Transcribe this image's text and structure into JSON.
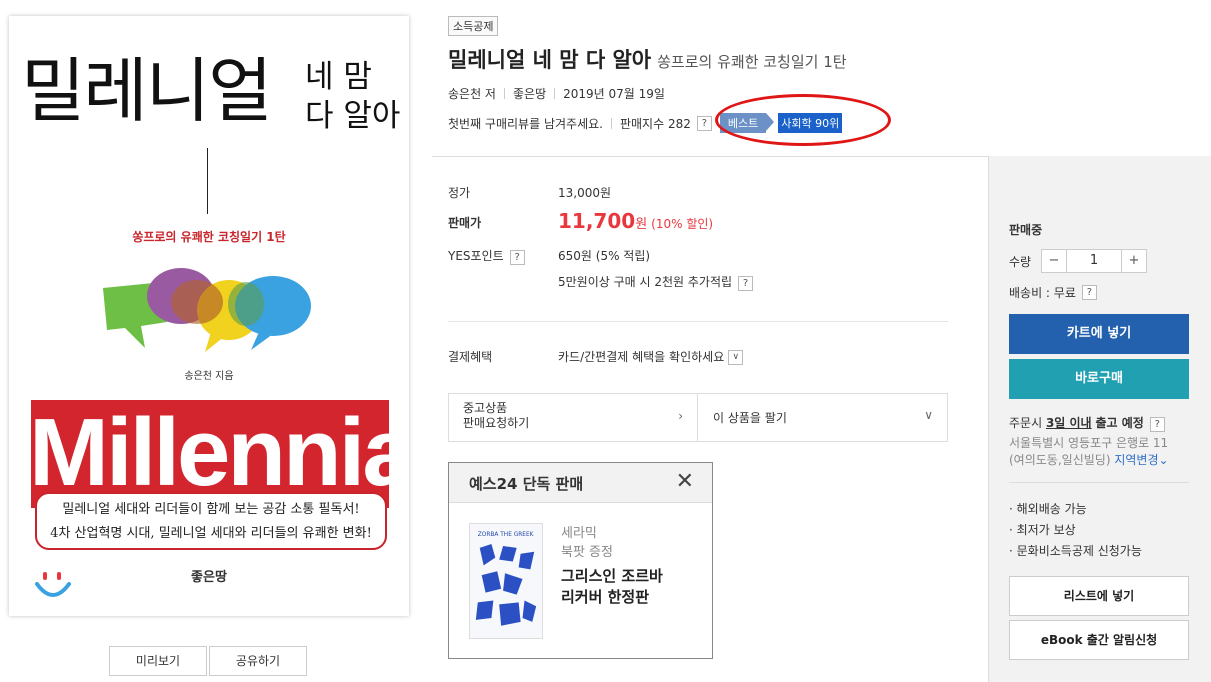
{
  "cover": {
    "title_main": "밀레니얼",
    "title_line1": "네 맘",
    "title_line2": "다 알아",
    "subtitle": "쏭프로의 유쾌한 코칭일기 1탄",
    "author": "송은천 지음",
    "big_word": "Millennial",
    "box_line1": "밀레니얼 세대와 리더들이 함께 보는 공감 소통 필독서!",
    "box_line2": "4차 산업혁명 시대, 밀레니얼 세대와 리더들의 유쾌한 변화!",
    "publisher": "좋은땅"
  },
  "cover_buttons": {
    "preview": "미리보기",
    "share": "공유하기"
  },
  "product": {
    "tag": "소득공제",
    "title": "밀레니얼 네 맘 다 알아",
    "subtitle": "쏭프로의 유쾌한 코칭일기 1탄",
    "author": "송은천 저",
    "publisher": "좋은땅",
    "date": "2019년 07월 19일",
    "review_prompt": "첫번째 구매리뷰를 남겨주세요.",
    "sales_index_label": "판매지수 282",
    "help": "?",
    "best_label": "베스트",
    "rank": "사회학 90위"
  },
  "price": {
    "list_label": "정가",
    "list_value": "13,000원",
    "sale_label": "판매가",
    "sale_value": "11,700",
    "sale_unit": "원",
    "sale_discount": "(10% 할인)",
    "points_label": "YES포인트",
    "points_value": "650원 (5% 적립)",
    "points_extra": "5만원이상 구매 시 2천원 추가적립",
    "payment_label": "결제혜택",
    "payment_value": "카드/간편결제 혜택을 확인하세요",
    "dropdown": "∨"
  },
  "used": {
    "left_line1": "중고상품",
    "left_line2": "판매요청하기",
    "left_arrow": "›",
    "right_label": "이 상품을 팔기",
    "right_arrow": "∨"
  },
  "exclusive": {
    "header": "예스24 단독 판매",
    "close": "✕",
    "brand1": "세라믹",
    "brand2": "북팟 증정",
    "name1": "그리스인 조르바",
    "name2": "리커버 한정판"
  },
  "panel": {
    "status": "판매중",
    "qty_label": "수량",
    "qty_minus": "−",
    "qty_value": "1",
    "qty_plus": "+",
    "shipping_fee": "배송비 : 무료",
    "cart": "카트에 넣기",
    "buy": "바로구매",
    "order_prefix": "주문시",
    "order_bold": "3일 이내",
    "order_suffix": "출고 예정",
    "addr_line1": "서울특별시 영등포구 은행로 11",
    "addr_line2": "(여의도동,일신빌딩)",
    "addr_link": "지역변경",
    "bullet1": "· 해외배송 가능",
    "bullet2": "· 최저가 보상",
    "bullet3": "· 문화비소득공제 신청가능",
    "wishlist": "리스트에 넣기",
    "ebook": "eBook 출간 알림신청"
  }
}
